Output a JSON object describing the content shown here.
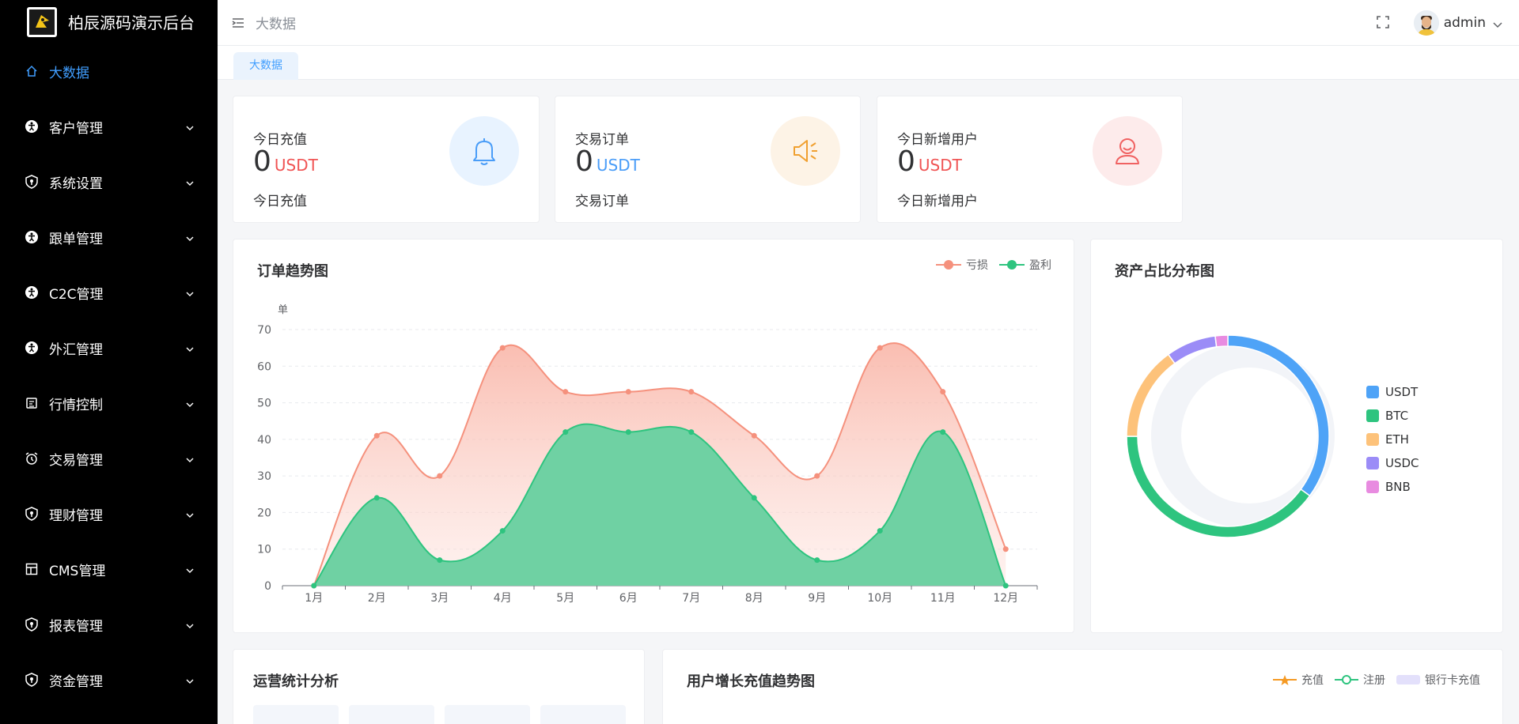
{
  "app": {
    "title": "柏辰源码演示后台"
  },
  "sidebar": {
    "items": [
      {
        "label": "大数据",
        "icon": "home-icon",
        "active": true
      },
      {
        "label": "客户管理",
        "icon": "accessibility-icon"
      },
      {
        "label": "系统设置",
        "icon": "shield-icon"
      },
      {
        "label": "跟单管理",
        "icon": "accessibility-icon"
      },
      {
        "label": "C2C管理",
        "icon": "accessibility-icon"
      },
      {
        "label": "外汇管理",
        "icon": "accessibility-icon"
      },
      {
        "label": "行情控制",
        "icon": "document-icon"
      },
      {
        "label": "交易管理",
        "icon": "alarm-clock-icon"
      },
      {
        "label": "理财管理",
        "icon": "shield-icon"
      },
      {
        "label": "CMS管理",
        "icon": "layout-icon"
      },
      {
        "label": "报表管理",
        "icon": "shield-icon"
      },
      {
        "label": "资金管理",
        "icon": "shield-icon"
      }
    ]
  },
  "header": {
    "breadcrumb": "大数据",
    "username": "admin"
  },
  "tabs": [
    {
      "label": "大数据"
    }
  ],
  "stats": [
    {
      "label": "今日充值",
      "value": "0",
      "unit": "USDT",
      "sub": "今日充值",
      "unit_color": "#f05454",
      "circle_bg": "#e8f3ff",
      "icon": "bell-icon",
      "icon_color": "#4a9df8"
    },
    {
      "label": "交易订单",
      "value": "0",
      "unit": "USDT",
      "sub": "交易订单",
      "unit_color": "#4a9df8",
      "circle_bg": "#fdf3e6",
      "icon": "speaker-icon",
      "icon_color": "#f0a030"
    },
    {
      "label": "今日新增用户",
      "value": "0",
      "unit": "USDT",
      "sub": "今日新增用户",
      "unit_color": "#f05454",
      "circle_bg": "#fdebeb",
      "icon": "user-icon",
      "icon_color": "#f06262"
    }
  ],
  "order_chart": {
    "title": "订单趋势图",
    "legend": [
      {
        "name": "亏损",
        "color": "#f5917d"
      },
      {
        "name": "盈利",
        "color": "#2ec47f"
      }
    ]
  },
  "asset_chart": {
    "title": "资产占比分布图"
  },
  "operations": {
    "title": "运营统计分析"
  },
  "growth_chart": {
    "title": "用户增长充值趋势图",
    "legend": [
      {
        "name": "充值",
        "color": "#f59a23"
      },
      {
        "name": "注册",
        "color": "#2ec47f"
      },
      {
        "name": "银行卡充值",
        "color": "#c9c4f7"
      }
    ]
  },
  "chart_data": [
    {
      "type": "area",
      "title": "订单趋势图",
      "ylabel": "单",
      "ylim": [
        0,
        70
      ],
      "yticks": [
        0,
        10,
        20,
        30,
        40,
        50,
        60,
        70
      ],
      "categories": [
        "1月",
        "2月",
        "3月",
        "4月",
        "5月",
        "6月",
        "7月",
        "8月",
        "9月",
        "10月",
        "11月",
        "12月"
      ],
      "series": [
        {
          "name": "亏损",
          "color": "#f5917d",
          "values": [
            0,
            41,
            30,
            65,
            53,
            53,
            53,
            41,
            30,
            65,
            53,
            10
          ]
        },
        {
          "name": "盈利",
          "color": "#2ec47f",
          "values": [
            0,
            24,
            7,
            15,
            42,
            42,
            42,
            24,
            7,
            15,
            42,
            0
          ]
        }
      ],
      "legend_position": "top-right"
    },
    {
      "type": "pie",
      "title": "资产占比分布图",
      "categories": [
        "USDT",
        "BTC",
        "ETH",
        "USDC",
        "BNB"
      ],
      "values": [
        35,
        40,
        15,
        8,
        2
      ],
      "colors": [
        "#4ea3f7",
        "#2ec47f",
        "#fdc27a",
        "#9b8cf7",
        "#e88be0"
      ],
      "legend_position": "right"
    }
  ]
}
